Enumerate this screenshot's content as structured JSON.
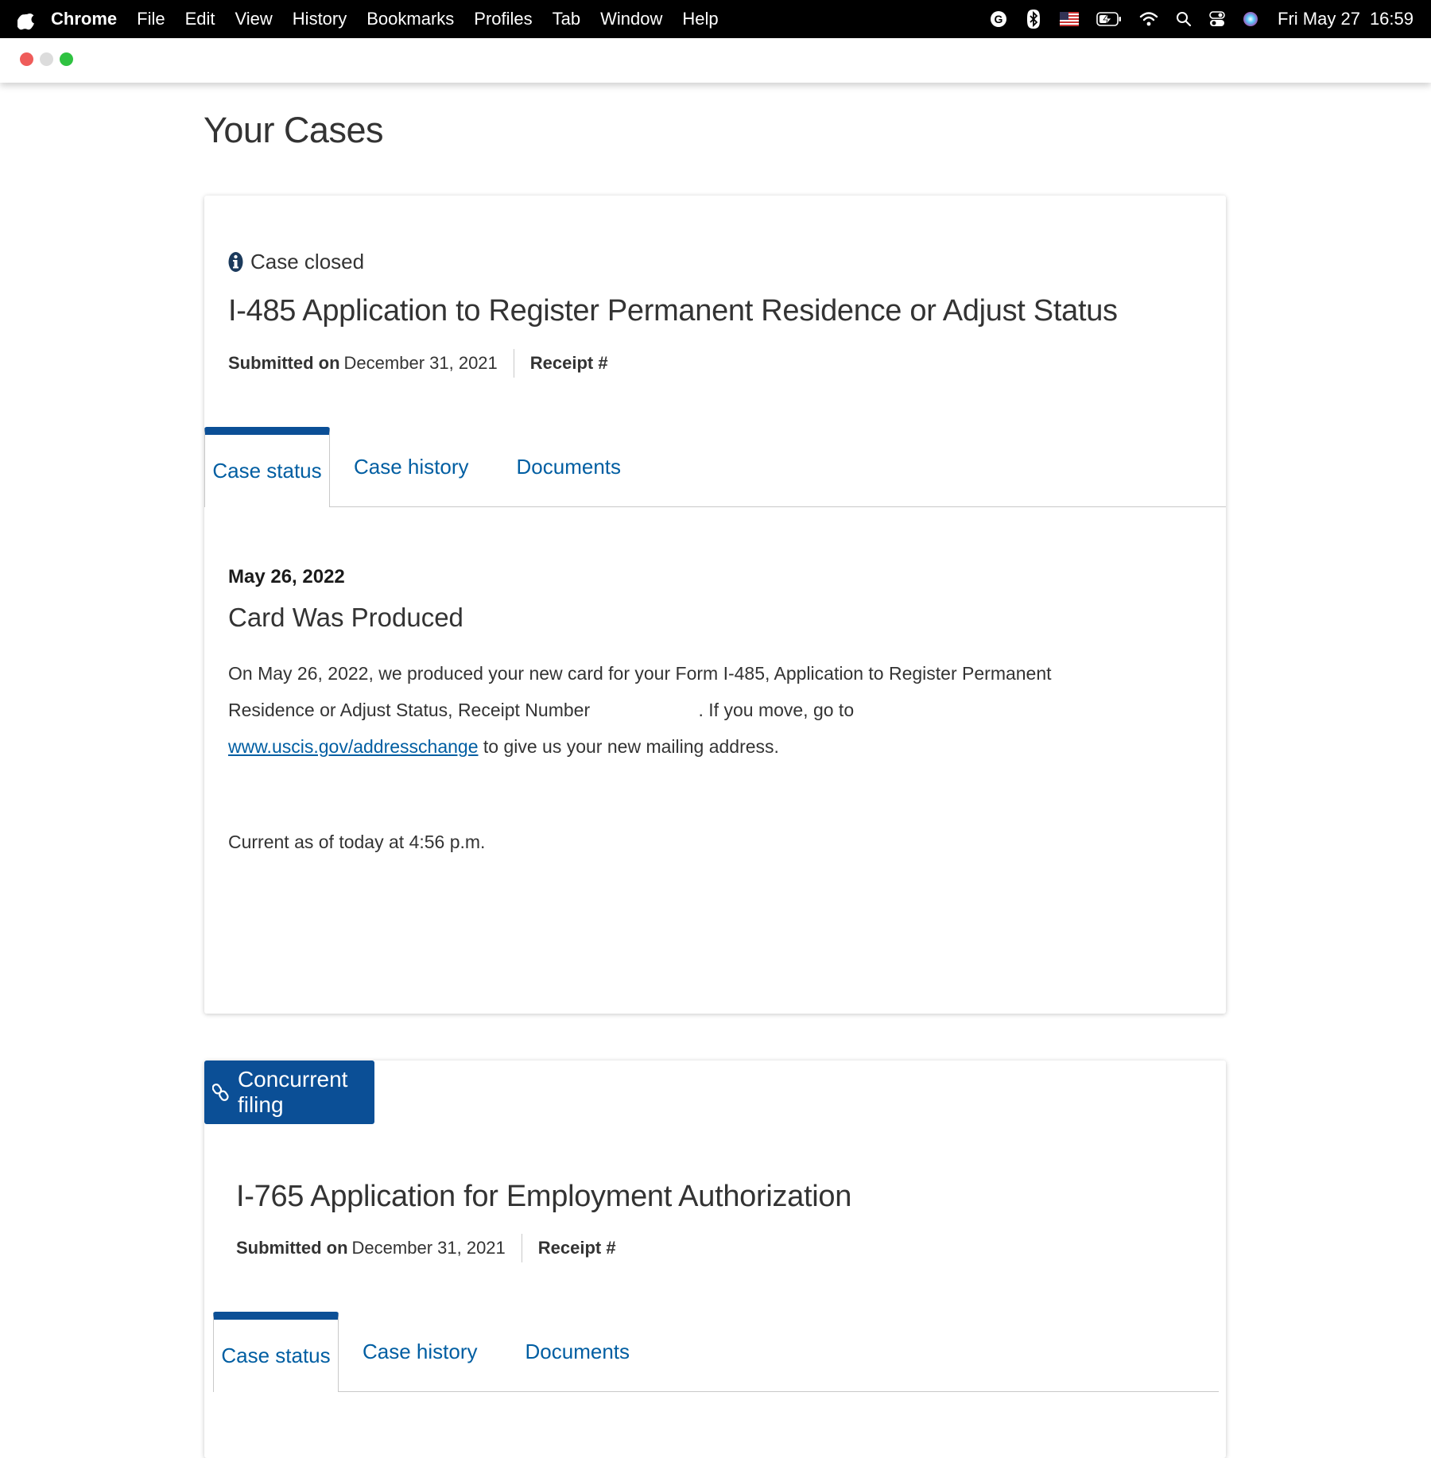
{
  "menubar": {
    "app_name": "Chrome",
    "items": [
      "File",
      "Edit",
      "View",
      "History",
      "Bookmarks",
      "Profiles",
      "Tab",
      "Window",
      "Help"
    ],
    "status_icons": [
      "grammarly-icon",
      "bluetooth-icon",
      "us-flag-input-icon",
      "battery-charging-icon",
      "wifi-icon",
      "spotlight-search-icon",
      "control-center-icon",
      "siri-icon"
    ],
    "clock": {
      "date": "Fri May 27",
      "time": "16:59"
    }
  },
  "page": {
    "title": "Your Cases"
  },
  "case1": {
    "status_label": "Case closed",
    "title": "I-485 Application to Register Permanent Residence or Adjust Status",
    "submitted_label": "Submitted on",
    "submitted_date": "December 31, 2021",
    "receipt_label": "Receipt #",
    "tabs": [
      "Case status",
      "Case history",
      "Documents"
    ],
    "event": {
      "date": "May 26, 2022",
      "title": "Card Was Produced",
      "body_part1": "On May 26, 2022, we produced your new card for your Form I-485, Application to Register Permanent Residence or Adjust Status, Receipt Number",
      "body_part2": ". If you move, go to",
      "link_text": "www.uscis.gov/addresschange",
      "body_part3": "to give us your new mailing address."
    },
    "current_as_of": "Current as of today at 4:56 p.m."
  },
  "case2": {
    "banner_label": "Concurrent filing",
    "title": "I-765 Application for Employment Authorization",
    "submitted_label": "Submitted on",
    "submitted_date": "December 31, 2021",
    "receipt_label": "Receipt #",
    "tabs": [
      "Case status",
      "Case history",
      "Documents"
    ]
  },
  "colors": {
    "accent_blue": "#0b4f96",
    "link_blue": "#005ea2",
    "menubar_bg": "#000000"
  }
}
